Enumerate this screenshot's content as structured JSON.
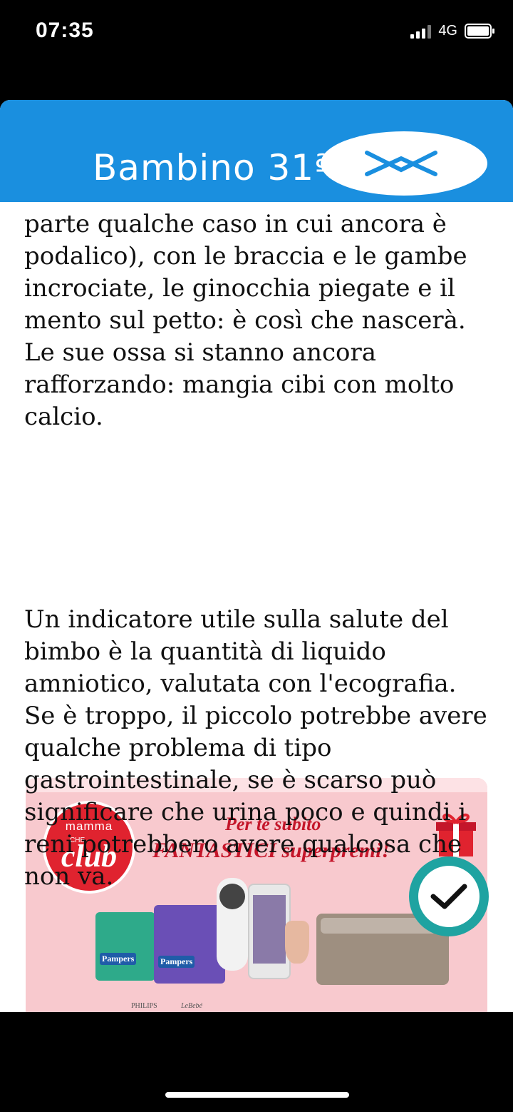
{
  "status_bar": {
    "time": "07:35",
    "network": "4G"
  },
  "header": {
    "title": "Bambino 31ª"
  },
  "article": {
    "paragraph1": "parte qualche caso in cui ancora è podalico), con le braccia e le gambe incrociate, le ginocchia piegate e il mento sul petto: è così che nascerà. Le sue ossa si stanno ancora rafforzando: mangia cibi con molto calcio.",
    "paragraph2": "Un indicatore utile sulla salute del bimbo è la quantità di liquido amniotico, valutata con l'ecografia. Se è troppo, il piccolo potrebbe avere qualche problema di tipo gastrointestinale, se è scarso può significare che urina poco e quindi i reni potrebbero avere qualcosa che non va."
  },
  "banner": {
    "logo_mamma": "mamma",
    "logo_che": "CHE",
    "logo_club": "club",
    "promo_line1": "Per te subito",
    "promo_line2": "FANTASTICI superpremi!",
    "product_label_1": "Pampers",
    "product_label_2": "Pampers",
    "brand_1": "PHILIPS",
    "brand_2": "LeBebé"
  },
  "colors": {
    "header": "#1a8fdf",
    "banner": "#f8c9ce",
    "accent_red": "#c4162a",
    "badge_teal": "#1fa3a1"
  },
  "icons": {
    "close": "close-icon",
    "check": "check-icon",
    "gift": "gift-icon"
  }
}
